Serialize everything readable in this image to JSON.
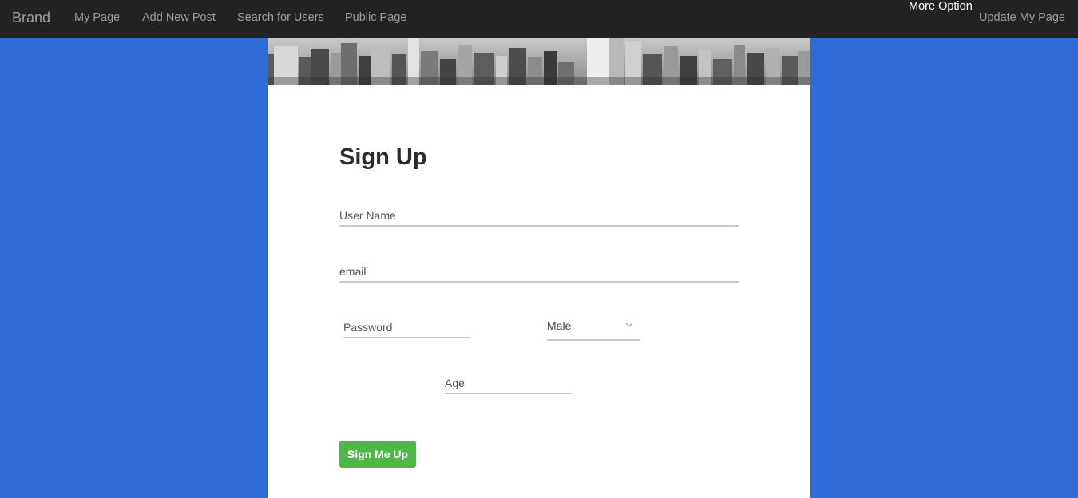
{
  "nav": {
    "brand": "Brand",
    "links": [
      "My Page",
      "Add New Post",
      "Search for Users",
      "Public Page"
    ],
    "more_option": "More Option",
    "update_page": "Update My Page"
  },
  "form": {
    "title": "Sign Up",
    "username_placeholder": "User Name",
    "email_placeholder": "email",
    "password_placeholder": "Password",
    "gender_value": "Male",
    "age_placeholder": "Age",
    "submit_label": "Sign Me Up"
  },
  "colors": {
    "background": "#2e6bd6",
    "navbar": "#222222",
    "button": "#4db848"
  }
}
